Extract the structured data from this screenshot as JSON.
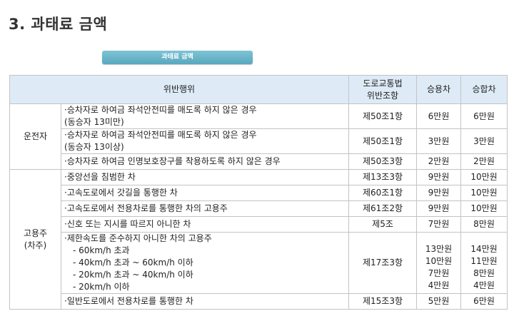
{
  "heading": "3. 과태료 금액",
  "tab_pill": "과태료 금액",
  "table": {
    "headers": {
      "violation": "위반행위",
      "law": [
        "도로교통법",
        "위반조항"
      ],
      "car": "승용차",
      "van": "승합차"
    },
    "groups": [
      {
        "label": [
          "운전자"
        ],
        "rows": [
          {
            "text": [
              "·승차자로 하여금 좌석안전띠를 매도록 하지 않은 경우",
              "(동승자 13미만)"
            ],
            "law": "제50조1항",
            "car": [
              "6만원"
            ],
            "van": [
              "6만원"
            ]
          },
          {
            "text": [
              "·승차자로 하여금 좌석안전띠를 매도록 하지 않은 경우",
              "(동승자 13이상)"
            ],
            "law": "제50조1항",
            "car": [
              "3만원"
            ],
            "van": [
              "3만원"
            ]
          },
          {
            "text": [
              "·승차자로 하여금 인명보호장구를 착용하도록 하지 않은 경우"
            ],
            "law": "제50조3항",
            "car": [
              "2만원"
            ],
            "van": [
              "2만원"
            ]
          }
        ]
      },
      {
        "label": [
          "고용주",
          "(차주)"
        ],
        "rows": [
          {
            "text": [
              "·중앙선을 침범한 차"
            ],
            "law": "제13조3항",
            "car": [
              "9만원"
            ],
            "van": [
              "10만원"
            ]
          },
          {
            "text": [
              "·고속도로에서 갓길을 통행한 차"
            ],
            "law": "제60조1항",
            "car": [
              "9만원"
            ],
            "van": [
              "10만원"
            ]
          },
          {
            "text": [
              "·고속도로에서 전용차로를 통행한 차의 고용주"
            ],
            "law": "제61조2항",
            "car": [
              "9만원"
            ],
            "van": [
              "10만원"
            ]
          },
          {
            "text": [
              "·신호 또는 지시를 따르지 아니한 차"
            ],
            "law": "제5조",
            "car": [
              "7만원"
            ],
            "van": [
              "8만원"
            ]
          },
          {
            "text": [
              "·제한속도를 준수하지 아니한 차의 고용주",
              "- 60km/h 초과",
              "- 40km/h 초과 ~ 60km/h 이하",
              "- 20km/h 초과 ~ 40km/h 이하",
              "- 20km/h 이하"
            ],
            "law": "제17조3항",
            "car": [
              "13만원",
              "10만원",
              "7만원",
              "4만원"
            ],
            "van": [
              "14만원",
              "11만원",
              "8만원",
              "4만원"
            ]
          },
          {
            "text": [
              "·일반도로에서 전용차로를 통행한 차"
            ],
            "law": "제15조3항",
            "car": [
              "5만원"
            ],
            "van": [
              "6만원"
            ]
          }
        ]
      }
    ]
  }
}
